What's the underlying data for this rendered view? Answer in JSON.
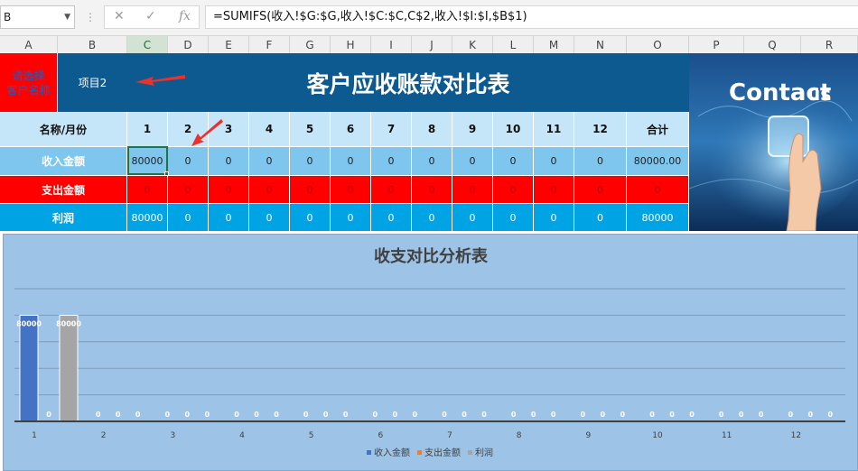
{
  "formula_bar": {
    "name_box": "B",
    "cancel_icon": "close-icon",
    "enter_icon": "check-icon",
    "fx_label": "fx",
    "formula": "=SUMIFS(收入!$G:$G,收入!$C:$C,C$2,收入!$I:$I,$B$1)"
  },
  "columns": [
    "A",
    "B",
    "C",
    "D",
    "E",
    "F",
    "G",
    "H",
    "I",
    "J",
    "K",
    "L",
    "M",
    "N",
    "O",
    "P",
    "Q",
    "R"
  ],
  "selected_column": "C",
  "sheet": {
    "picker_label": "请选择\n客户名称",
    "project": "项目2",
    "title": "客户应收账款对比表",
    "header": {
      "label": "名称/月份",
      "months": [
        "1",
        "2",
        "3",
        "4",
        "5",
        "6",
        "7",
        "8",
        "9",
        "10",
        "11",
        "12"
      ],
      "total": "合计"
    },
    "rows": [
      {
        "label": "收入金额",
        "values": [
          "80000",
          "0",
          "0",
          "0",
          "0",
          "0",
          "0",
          "0",
          "0",
          "0",
          "0",
          "0"
        ],
        "total": "80000.00"
      },
      {
        "label": "支出金额",
        "values": [
          "0",
          "0",
          "0",
          "0",
          "0",
          "0",
          "0",
          "0",
          "0",
          "0",
          "0",
          "0"
        ],
        "total": "0"
      },
      {
        "label": "利润",
        "values": [
          "80000",
          "0",
          "0",
          "0",
          "0",
          "0",
          "0",
          "0",
          "0",
          "0",
          "0",
          "0"
        ],
        "total": "80000"
      }
    ],
    "image_caption": "Contact us"
  },
  "accent_colors": {
    "header_blue": "#0c5a8f",
    "picker_red": "#ff0000",
    "arrow_red": "#e8322e",
    "excel_green": "#217346"
  },
  "chart_data": {
    "type": "bar",
    "title": "收支对比分析表",
    "categories": [
      "1",
      "2",
      "3",
      "4",
      "5",
      "6",
      "7",
      "8",
      "9",
      "10",
      "11",
      "12"
    ],
    "series": [
      {
        "name": "收入金额",
        "color": "#4472c4",
        "values": [
          80000,
          0,
          0,
          0,
          0,
          0,
          0,
          0,
          0,
          0,
          0,
          0
        ]
      },
      {
        "name": "支出金额",
        "color": "#ed7d31",
        "values": [
          0,
          0,
          0,
          0,
          0,
          0,
          0,
          0,
          0,
          0,
          0,
          0
        ]
      },
      {
        "name": "利润",
        "color": "#a5a5a5",
        "values": [
          80000,
          0,
          0,
          0,
          0,
          0,
          0,
          0,
          0,
          0,
          0,
          0
        ]
      }
    ],
    "ylim": [
      0,
      100000
    ],
    "grid": true,
    "data_labels": true,
    "legend": "bottom"
  }
}
